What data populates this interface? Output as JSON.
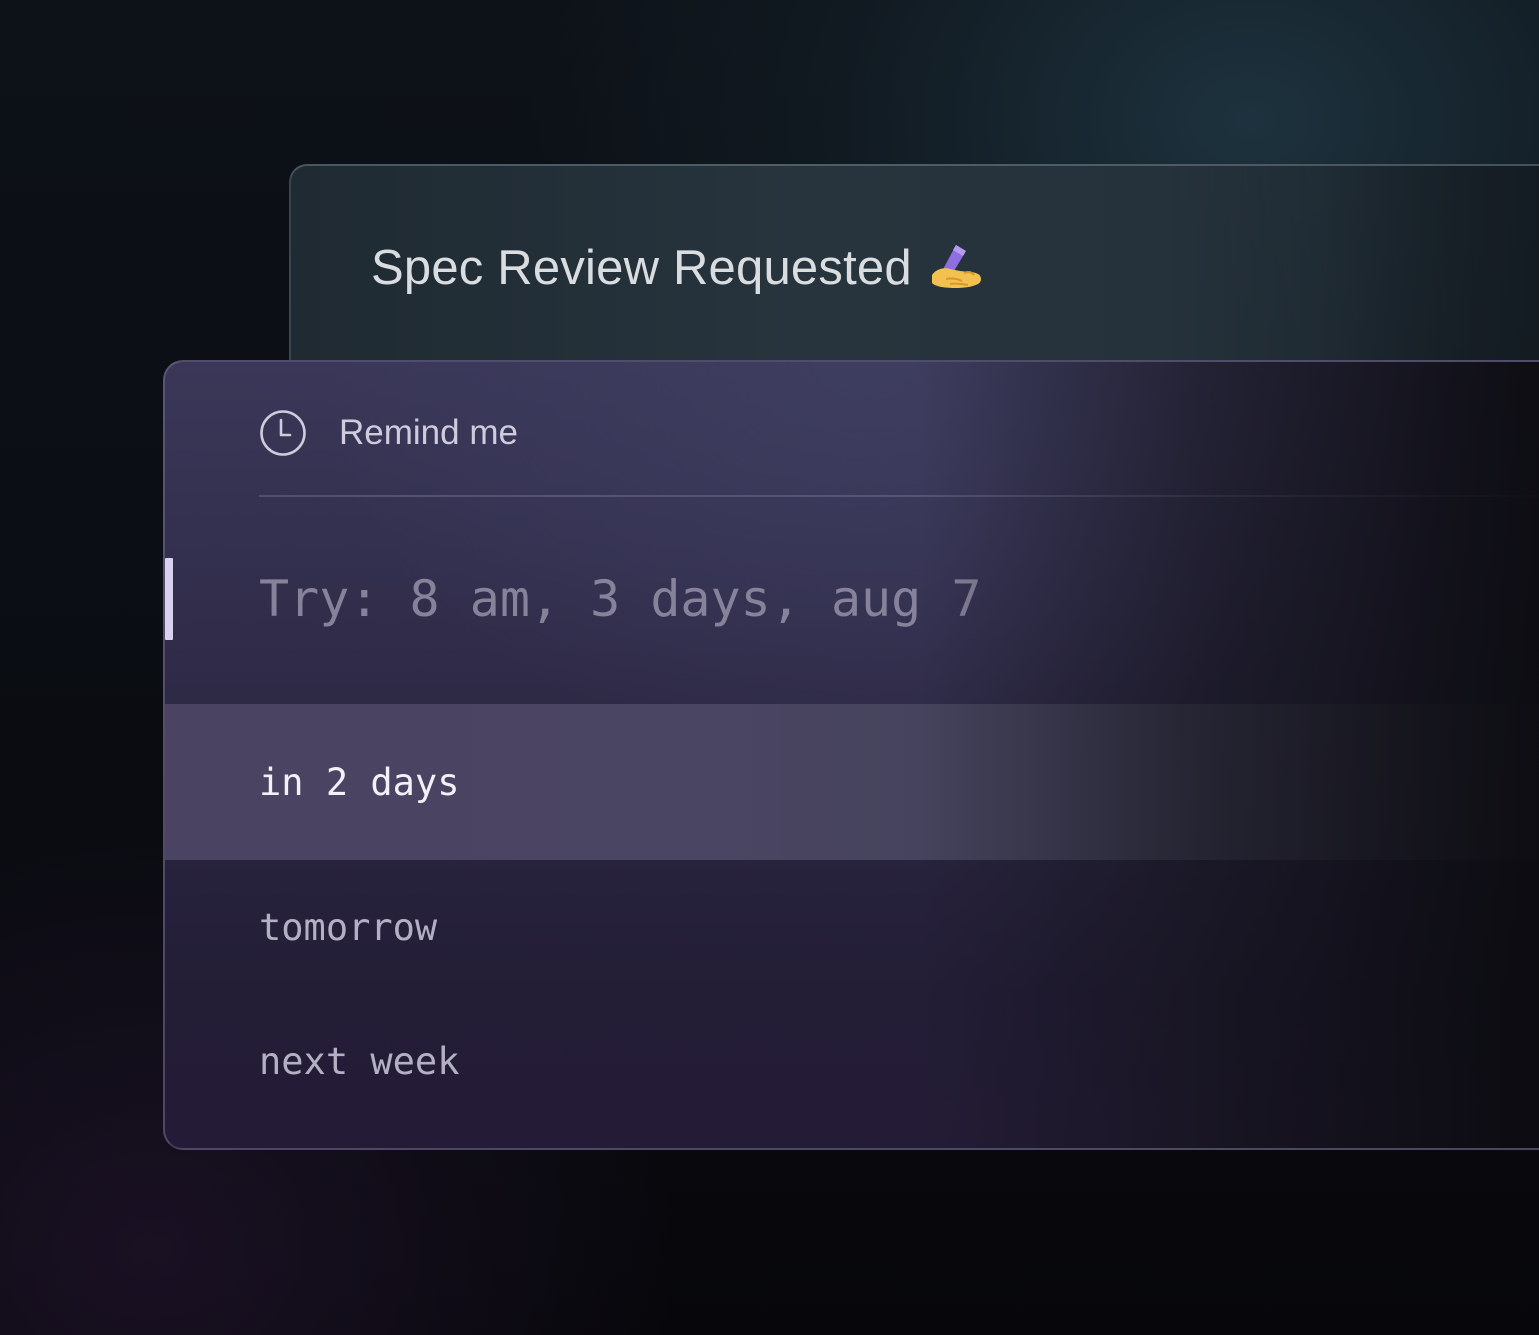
{
  "notification": {
    "title": "Spec Review Requested",
    "title_emoji_icon": "writing-hand-icon"
  },
  "reminder": {
    "header_icon": "clock-icon",
    "header_label": "Remind me",
    "input": {
      "value": "",
      "placeholder": "Try: 8 am, 3 days, aug 7"
    },
    "options": [
      {
        "label": "in 2 days",
        "selected": true
      },
      {
        "label": "tomorrow",
        "selected": false
      },
      {
        "label": "next week",
        "selected": false
      }
    ]
  },
  "colors": {
    "cursor": "#d8d2ee",
    "selected_row": "#4a4462",
    "card_background": "#332f4e",
    "back_card_background": "#27343d"
  }
}
